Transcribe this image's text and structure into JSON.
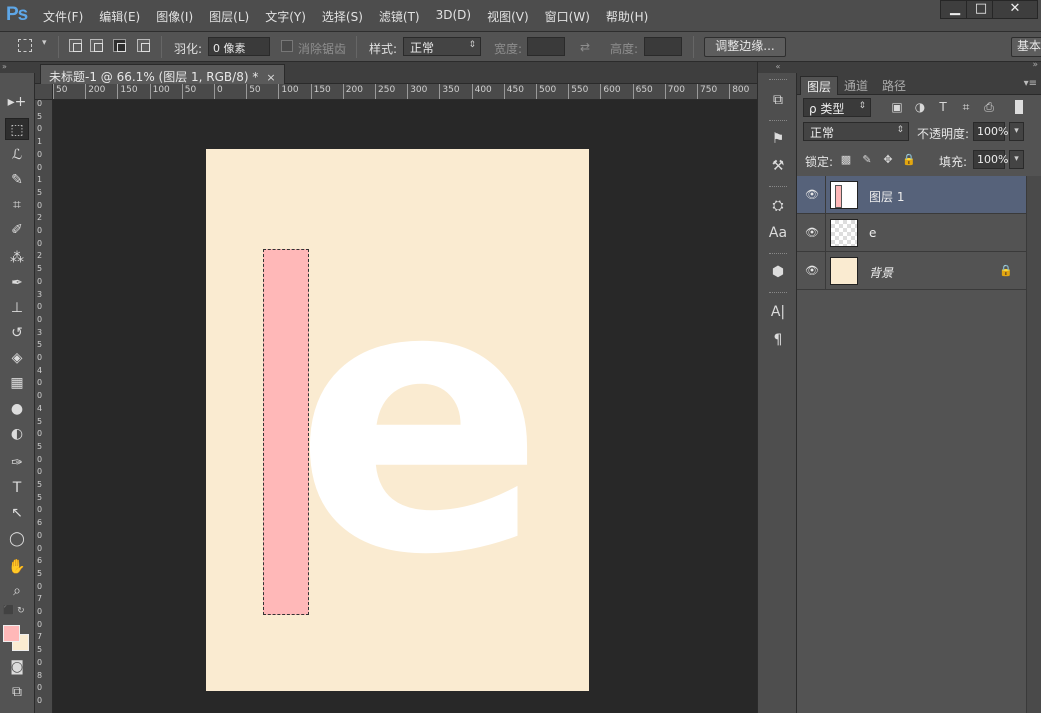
{
  "app": {
    "logo": "Ps"
  },
  "menu": [
    "文件(F)",
    "编辑(E)",
    "图像(I)",
    "图层(L)",
    "文字(Y)",
    "选择(S)",
    "滤镜(T)",
    "3D(D)",
    "视图(V)",
    "窗口(W)",
    "帮助(H)"
  ],
  "window_controls": {
    "minimize": "▁",
    "maximize": "□",
    "close": "✕"
  },
  "options": {
    "feather_label": "羽化:",
    "feather_value": "0 像素",
    "antialias_label": "消除锯齿",
    "style_label": "样式:",
    "style_value": "正常",
    "width_label": "宽度:",
    "swap_icon": "⇄",
    "height_label": "高度:",
    "refine_edge": "调整边缘...",
    "workspace": "基本"
  },
  "document": {
    "tab_title": "未标题-1 @ 66.1% (图层 1, RGB/8) *",
    "close": "×",
    "letter": "e"
  },
  "ruler_h": [
    "50",
    "200",
    "150",
    "100",
    "50",
    "0",
    "50",
    "100",
    "150",
    "200",
    "250",
    "300",
    "350",
    "400",
    "450",
    "500",
    "550",
    "600",
    "650",
    "700",
    "750",
    "800"
  ],
  "ruler_v": [
    "0",
    "5",
    "0",
    "1",
    "0",
    "0",
    "1",
    "5",
    "0",
    "2",
    "0",
    "0",
    "2",
    "5",
    "0",
    "3",
    "0",
    "0",
    "3",
    "5",
    "0",
    "4",
    "0",
    "0",
    "4",
    "5",
    "0",
    "5",
    "0",
    "0",
    "5",
    "5",
    "0",
    "6",
    "0",
    "0",
    "6",
    "5",
    "0",
    "7",
    "0",
    "0",
    "7",
    "5",
    "0",
    "8",
    "0",
    "0"
  ],
  "tools": [
    "▸+",
    "⬚",
    "ℒ",
    "✎",
    "⌗",
    "✐",
    "⁂",
    "✒",
    "⊥",
    "↺",
    "◈",
    "▦",
    "●",
    "◐",
    "✑",
    "T",
    "↖",
    "◯",
    "✋",
    "⌕"
  ],
  "colors": {
    "foreground": "#ffb8b8",
    "background": "#faebd1",
    "canvas": "#faebd1",
    "selection": "#ffb8b8",
    "selected_layer": "#56627a"
  },
  "mid_icons": [
    "⧉",
    "⚑",
    "⚒",
    "⛭",
    "Aa",
    "⬢",
    "A|",
    "¶"
  ],
  "layers_panel": {
    "tabs": [
      "图层",
      "通道",
      "路径"
    ],
    "filter_label": "ρ 类型",
    "filter_icons": [
      "▣",
      "◑",
      "T",
      "⌗",
      "⎙"
    ],
    "blend_mode": "正常",
    "opacity_label": "不透明度:",
    "opacity_value": "100%",
    "lock_label": "锁定:",
    "lock_icons": [
      "▩",
      "✎",
      "✥",
      "🔒"
    ],
    "fill_label": "填充:",
    "fill_value": "100%",
    "layers": [
      {
        "name": "图层 1",
        "thumb": "pink",
        "selected": true,
        "italic": false,
        "locked": false
      },
      {
        "name": "e",
        "thumb": "transparent",
        "selected": false,
        "italic": false,
        "locked": false
      },
      {
        "name": "背景",
        "thumb": "cream",
        "selected": false,
        "italic": true,
        "locked": true
      }
    ]
  }
}
